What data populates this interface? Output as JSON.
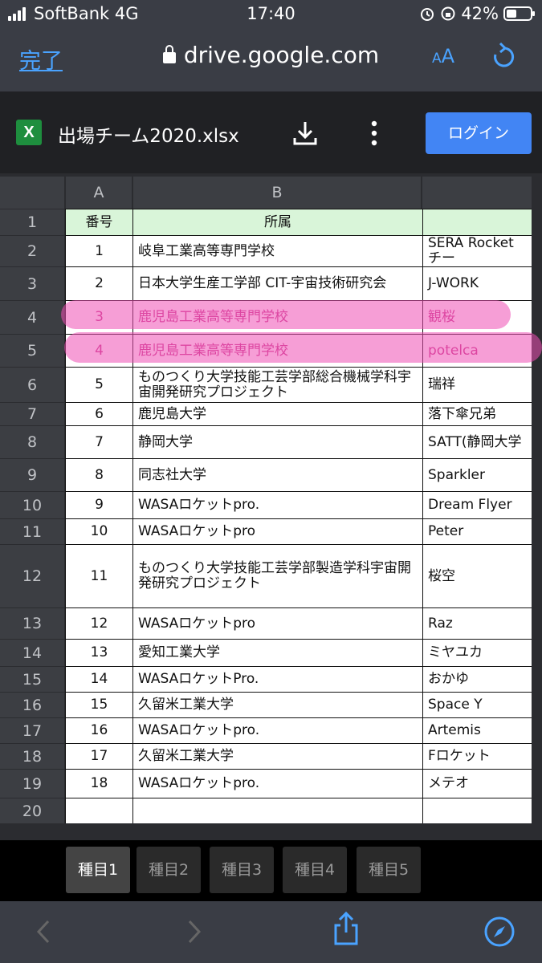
{
  "status": {
    "carrier": "SoftBank",
    "network": "4G",
    "time": "17:40",
    "battery": "42%"
  },
  "nav": {
    "done": "完了",
    "url": "drive.google.com",
    "text_size_big": "A",
    "text_size_small": "A"
  },
  "file": {
    "icon_letter": "X",
    "name": "出場チーム2020.xlsx",
    "login": "ログイン"
  },
  "columns": [
    "A",
    "B"
  ],
  "header_row": {
    "num": "1",
    "a": "番号",
    "b": "所属",
    "c": ""
  },
  "rows": [
    {
      "num": "2",
      "a": "1",
      "b": "岐阜工業高等専門学校",
      "c": "SERA Rocketチー"
    },
    {
      "num": "3",
      "a": "2",
      "b": "日本大学生産工学部 CIT-宇宙技術研究会",
      "c": "J-WORK"
    },
    {
      "num": "4",
      "a": "3",
      "b": "鹿児島工業高等専門学校",
      "c": "観桜"
    },
    {
      "num": "5",
      "a": "4",
      "b": "鹿児島工業高等専門学校",
      "c": "potelca"
    },
    {
      "num": "6",
      "a": "5",
      "b": "ものつくり大学技能工芸学部総合機械学科宇宙開発研究プロジェクト",
      "c": "瑞祥"
    },
    {
      "num": "7",
      "a": "6",
      "b": "鹿児島大学",
      "c": "落下傘兄弟"
    },
    {
      "num": "8",
      "a": "7",
      "b": "静岡大学",
      "c": "SATT(静岡大学"
    },
    {
      "num": "9",
      "a": "8",
      "b": "同志社大学",
      "c": "Sparkler"
    },
    {
      "num": "10",
      "a": "9",
      "b": "WASAロケットpro.",
      "c": "Dream Flyer"
    },
    {
      "num": "11",
      "a": "10",
      "b": "WASAロケットpro",
      "c": "Peter"
    },
    {
      "num": "12",
      "a": "11",
      "b": "ものつくり大学技能工芸学部製造学科宇宙開発研究プロジェクト",
      "c": "桜空"
    },
    {
      "num": "13",
      "a": "12",
      "b": "WASAロケットpro",
      "c": "Raz"
    },
    {
      "num": "14",
      "a": "13",
      "b": "愛知工業大学",
      "c": "ミヤユカ"
    },
    {
      "num": "15",
      "a": "14",
      "b": "WASAロケットPro.",
      "c": "おかゆ"
    },
    {
      "num": "16",
      "a": "15",
      "b": "久留米工業大学",
      "c": "Space Y"
    },
    {
      "num": "17",
      "a": "16",
      "b": "WASAロケットpro.",
      "c": "Artemis"
    },
    {
      "num": "18",
      "a": "17",
      "b": "久留米工業大学",
      "c": "Fロケット"
    },
    {
      "num": "19",
      "a": "18",
      "b": "WASAロケットpro.",
      "c": "メテオ"
    },
    {
      "num": "20",
      "a": "",
      "b": "",
      "c": ""
    }
  ],
  "tabs": [
    "種目1",
    "種目2",
    "種目3",
    "種目4",
    "種目5"
  ]
}
